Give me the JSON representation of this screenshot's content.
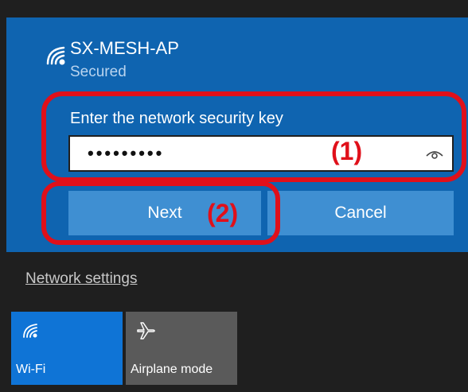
{
  "network": {
    "name": "SX-MESH-AP",
    "status": "Secured",
    "icon": "wifi-icon"
  },
  "security_key": {
    "label": "Enter the network security key",
    "masked_value": "•••••••••",
    "reveal_icon": "eye-icon"
  },
  "buttons": {
    "next": "Next",
    "cancel": "Cancel"
  },
  "annotations": {
    "one": "(1)",
    "two": "(2)",
    "color": "#e0101a"
  },
  "footer": {
    "settings_link": "Network settings"
  },
  "quick_actions": [
    {
      "label": "Wi-Fi",
      "icon": "wifi-icon",
      "active": true
    },
    {
      "label": "Airplane mode",
      "icon": "airplane-icon",
      "active": false
    }
  ],
  "colors": {
    "panel": "#0f64b0",
    "button": "#3f8fd2",
    "wifi_tile": "#0f74d6",
    "airplane_tile": "#5a5a5a",
    "background": "#1f1f1f"
  }
}
